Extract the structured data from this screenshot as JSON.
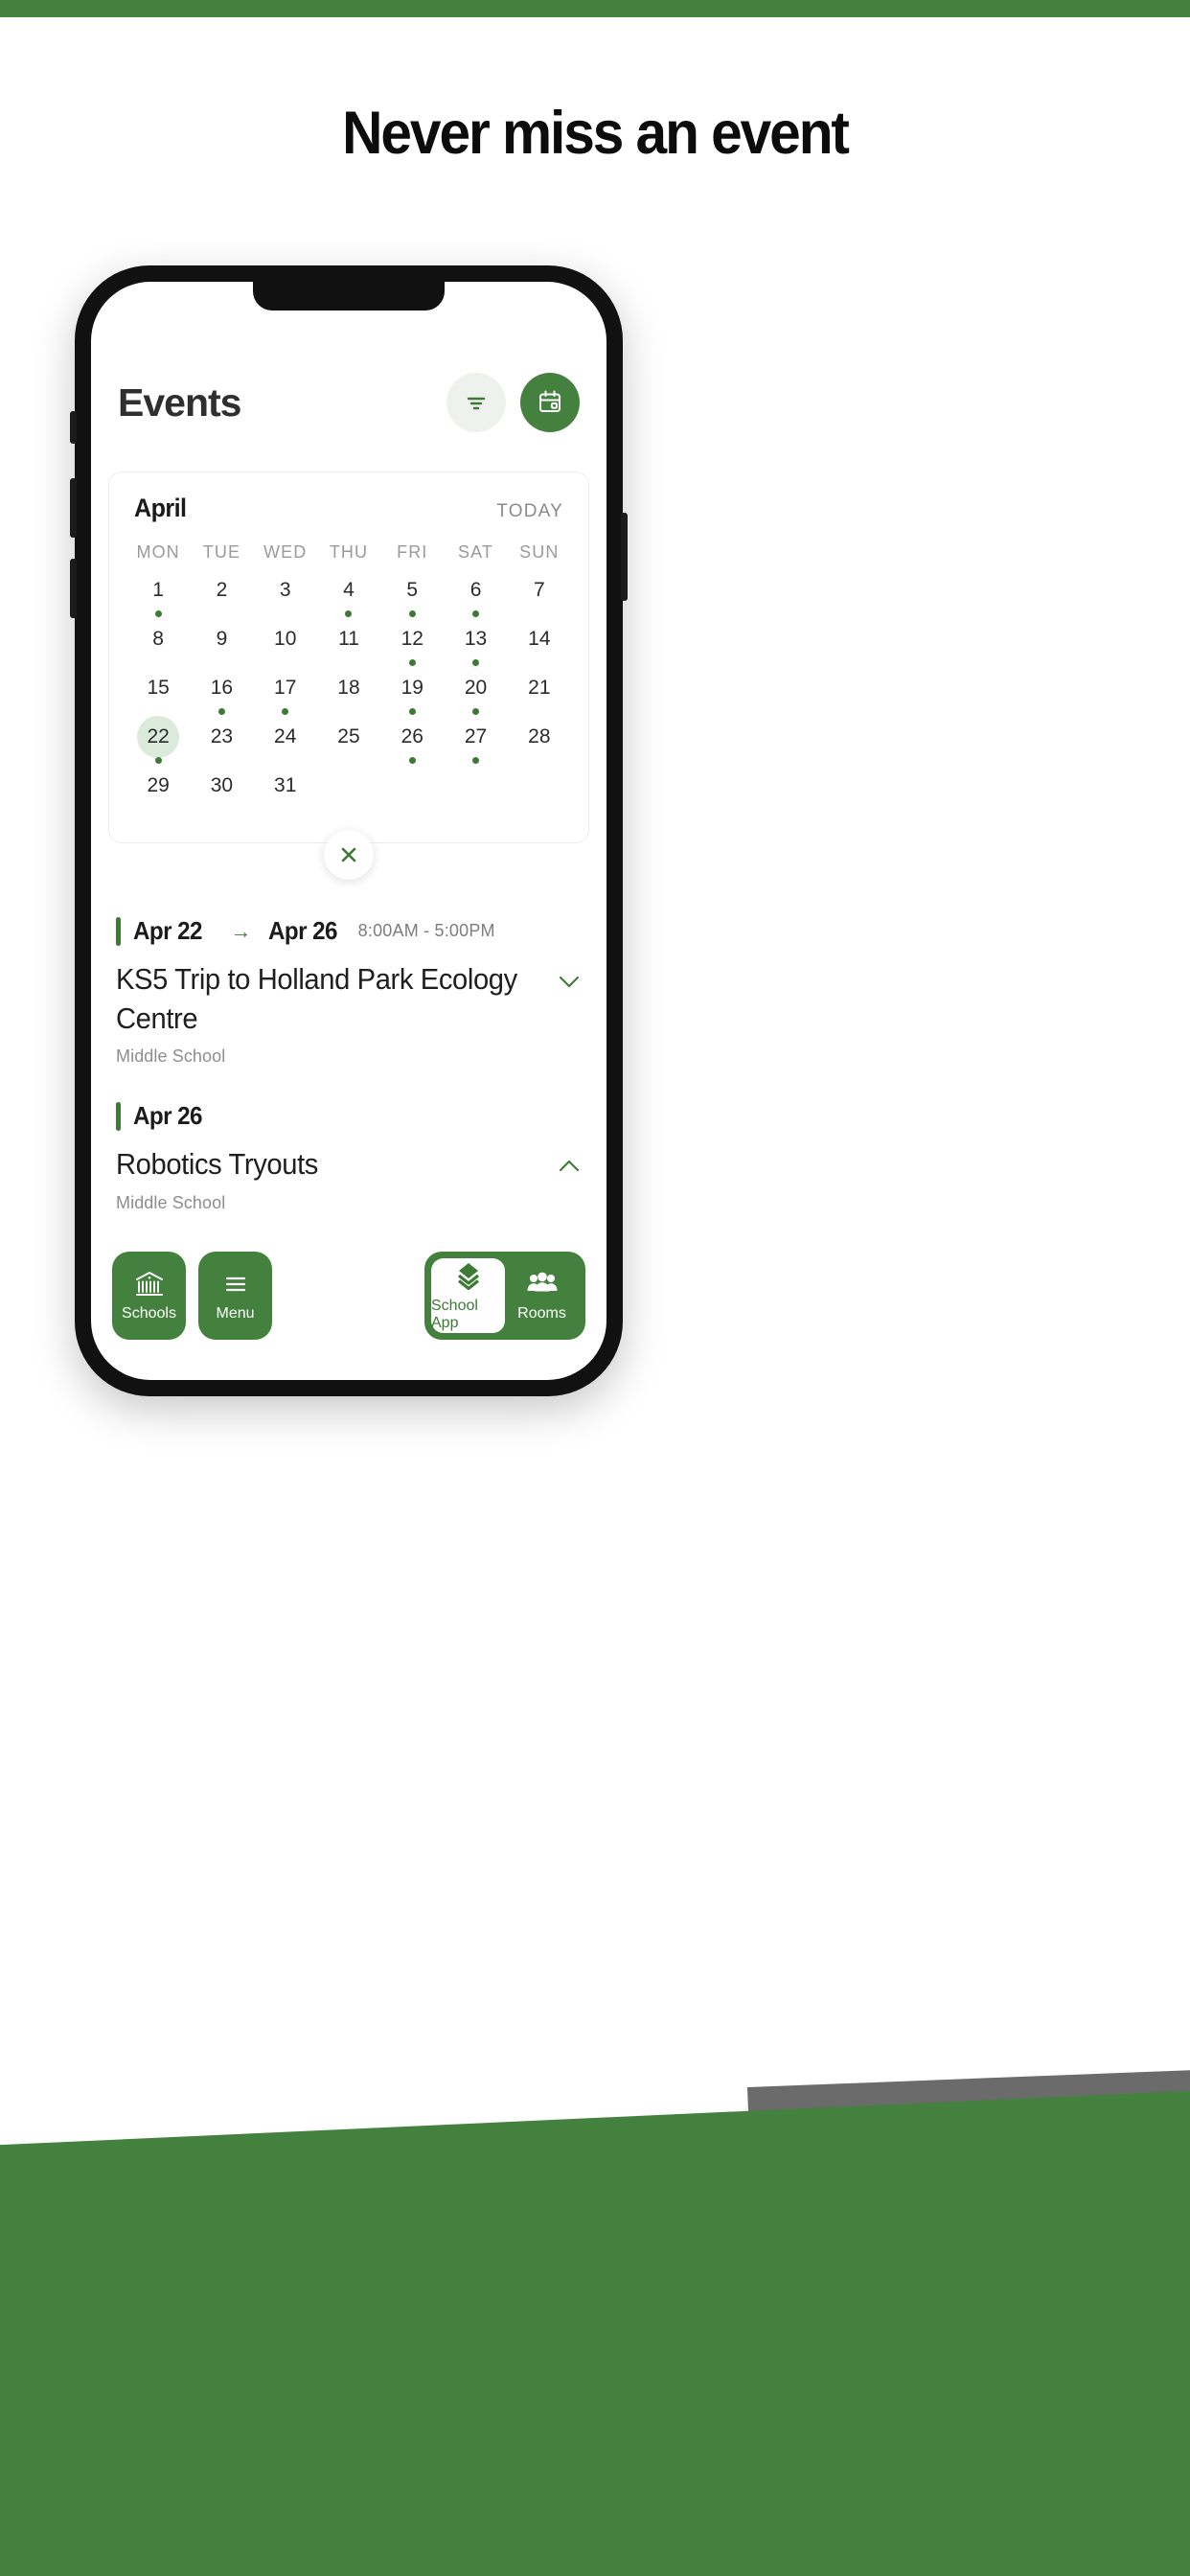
{
  "colors": {
    "brand_green": "#45813E",
    "accent_green": "#3d7a34",
    "selected_day_bg": "#dceadb",
    "gray_band": "#6b6b6b"
  },
  "headline": "Never miss an event",
  "app": {
    "header": {
      "title": "Events",
      "filter_button_icon": "filter-icon",
      "calendar_button_icon": "calendar-icon"
    },
    "calendar": {
      "month": "April",
      "today_label": "TODAY",
      "day_headers": [
        "MON",
        "TUE",
        "WED",
        "THU",
        "FRI",
        "SAT",
        "SUN"
      ],
      "weeks": [
        [
          {
            "day": "1",
            "dot": true,
            "selected": false
          },
          {
            "day": "2",
            "dot": false,
            "selected": false
          },
          {
            "day": "3",
            "dot": false,
            "selected": false
          },
          {
            "day": "4",
            "dot": true,
            "selected": false
          },
          {
            "day": "5",
            "dot": true,
            "selected": false
          },
          {
            "day": "6",
            "dot": true,
            "selected": false
          },
          {
            "day": "7",
            "dot": false,
            "selected": false
          }
        ],
        [
          {
            "day": "8",
            "dot": false,
            "selected": false
          },
          {
            "day": "9",
            "dot": false,
            "selected": false
          },
          {
            "day": "10",
            "dot": false,
            "selected": false
          },
          {
            "day": "11",
            "dot": false,
            "selected": false
          },
          {
            "day": "12",
            "dot": true,
            "selected": false
          },
          {
            "day": "13",
            "dot": true,
            "selected": false
          },
          {
            "day": "14",
            "dot": false,
            "selected": false
          }
        ],
        [
          {
            "day": "15",
            "dot": false,
            "selected": false
          },
          {
            "day": "16",
            "dot": true,
            "selected": false
          },
          {
            "day": "17",
            "dot": true,
            "selected": false
          },
          {
            "day": "18",
            "dot": false,
            "selected": false
          },
          {
            "day": "19",
            "dot": true,
            "selected": false
          },
          {
            "day": "20",
            "dot": true,
            "selected": false
          },
          {
            "day": "21",
            "dot": false,
            "selected": false
          }
        ],
        [
          {
            "day": "22",
            "dot": true,
            "selected": true
          },
          {
            "day": "23",
            "dot": false,
            "selected": false
          },
          {
            "day": "24",
            "dot": false,
            "selected": false
          },
          {
            "day": "25",
            "dot": false,
            "selected": false
          },
          {
            "day": "26",
            "dot": true,
            "selected": false
          },
          {
            "day": "27",
            "dot": true,
            "selected": false
          },
          {
            "day": "28",
            "dot": false,
            "selected": false
          }
        ],
        [
          {
            "day": "29",
            "dot": false,
            "selected": false
          },
          {
            "day": "30",
            "dot": false,
            "selected": false
          },
          {
            "day": "31",
            "dot": false,
            "selected": false
          },
          {
            "day": "",
            "dot": false,
            "selected": false
          },
          {
            "day": "",
            "dot": false,
            "selected": false
          },
          {
            "day": "",
            "dot": false,
            "selected": false
          },
          {
            "day": "",
            "dot": false,
            "selected": false
          }
        ]
      ],
      "close_button_icon": "close-icon"
    },
    "events": [
      {
        "start_date": "Apr 22",
        "range_arrow": "→",
        "end_date": "Apr 26",
        "time": "8:00AM  -  5:00PM",
        "title": "KS5 Trip to Holland Park Ecology Centre",
        "subtitle": "Middle School",
        "expand_icon": "chevron-down-icon"
      },
      {
        "start_date": "Apr 26",
        "range_arrow": "",
        "end_date": "",
        "time": "",
        "title": "Robotics Tryouts",
        "subtitle": "Middle School",
        "expand_icon": "chevron-up-icon"
      }
    ],
    "bottom_nav": {
      "tiles": [
        {
          "label": "Schools",
          "icon": "bank-building-icon"
        },
        {
          "label": "Menu",
          "icon": "hamburger-menu-icon"
        }
      ],
      "pill": [
        {
          "label": "School App",
          "icon": "layers-icon",
          "active": true
        },
        {
          "label": "Rooms",
          "icon": "people-group-icon",
          "active": false
        }
      ]
    }
  }
}
